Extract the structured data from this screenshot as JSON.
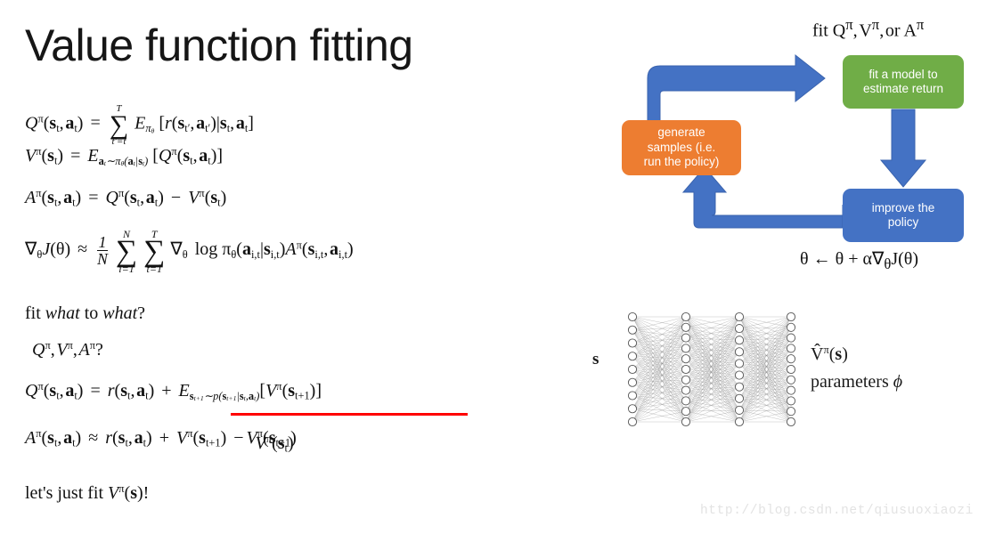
{
  "slide": {
    "title": "Value function fitting",
    "watermark": "http://blog.csdn.net/qiusuoxiaozi"
  },
  "equations": {
    "q_definition": "Q^pi(s_t,a_t) = sum_{t'=t}^{T} E_{pi_theta}[ r(s_t',a_t') | s_t,a_t ]",
    "v_definition": "V^pi(s_t) = E_{a_t ~ pi_theta(a_t|s_t)}[ Q^pi(s_t,a_t) ]",
    "a_definition": "A^pi(s_t,a_t) = Q^pi(s_t,a_t) - V^pi(s_t)",
    "policy_gradient": "grad_theta J(theta) ~= (1/N) sum_{i=1}^{N} sum_{t=1}^{T} grad_theta log pi_theta(a_it|s_it) A^pi(s_it,a_it)",
    "fit_question": "fit what to what?",
    "candidates": "Q^pi, V^pi, A^pi ?",
    "q_bellman": "Q^pi(s_t,a_t) = r(s_t,a_t) + E_{s_{t+1} ~ p(s_{t+1}|s_t,a_t)}[ V^pi(s_{t+1}) ]",
    "a_approx": "A^pi(s_t,a_t) ~= r(s_t,a_t) + V^pi(s_{t+1}) - V^pi(s_t)",
    "conclusion": "let's just fit V^pi(s)!"
  },
  "labels": {
    "fit_label": "fit",
    "or_label": "or",
    "lets_just_fit": "let's just fit",
    "fit_word": "fit",
    "to_word": "to",
    "what_word": "what",
    "question_mark": "?",
    "bang": "!",
    "parameters_word": "parameters",
    "log_word": "log"
  },
  "cycle_diagram": {
    "caption_top": "fit Q^pi, V^pi, or A^pi",
    "caption_bottom": "theta <- theta + alpha grad_theta J(theta)",
    "boxes": [
      {
        "id": "green",
        "label": "fit a model to\nestimate return",
        "line1": "fit a model to",
        "line2": "estimate return",
        "color": "#70AD47"
      },
      {
        "id": "orange",
        "label": "generate samples (i.e. run the policy)",
        "line1": "generate",
        "line2": "samples (i.e.",
        "line3": "run the policy)",
        "color": "#ED7D31"
      },
      {
        "id": "blue",
        "label": "improve the policy",
        "line1": "improve the",
        "line2": "policy",
        "color": "#4472C4"
      }
    ],
    "arrow_color": "#4472C4",
    "arrows": [
      {
        "from": "orange",
        "to": "green",
        "shape": "up-right"
      },
      {
        "from": "green",
        "to": "blue",
        "shape": "down"
      },
      {
        "from": "blue",
        "to": "orange",
        "shape": "left-up"
      }
    ]
  },
  "neural_network": {
    "input_label": "s",
    "output_label": "V^pi(s)",
    "parameters_label": "parameters phi",
    "layer_sizes": [
      9,
      11,
      10,
      11
    ],
    "node_color": "#ffffff",
    "node_stroke": "#555555",
    "edge_color": "#8a8a8a"
  },
  "colors": {
    "highlight_underline": "#ff0000",
    "green": "#70AD47",
    "orange": "#ED7D31",
    "blue": "#4472C4",
    "text": "#111111",
    "watermark": "#e3e3e3"
  }
}
